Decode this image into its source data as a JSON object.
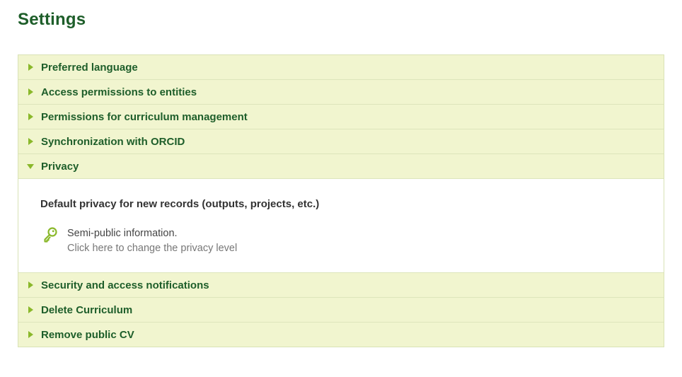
{
  "page": {
    "title": "Settings"
  },
  "sections": [
    {
      "label": "Preferred language",
      "expanded": false
    },
    {
      "label": "Access permissions to entities",
      "expanded": false
    },
    {
      "label": "Permissions for curriculum management",
      "expanded": false
    },
    {
      "label": "Synchronization with ORCID",
      "expanded": false
    },
    {
      "label": "Privacy",
      "expanded": true
    },
    {
      "label": "Security and access notifications",
      "expanded": false
    },
    {
      "label": "Delete Curriculum",
      "expanded": false
    },
    {
      "label": "Remove public CV",
      "expanded": false
    }
  ],
  "privacy": {
    "heading": "Default privacy for new records (outputs, projects, etc.)",
    "level": "Semi-public information.",
    "change_link": "Click here to change the privacy level",
    "icon": "key-icon"
  },
  "colors": {
    "title": "#1e5e2a",
    "header_bg": "#f1f5cf",
    "caret": "#8ab82a",
    "border": "#d9e2b6"
  }
}
